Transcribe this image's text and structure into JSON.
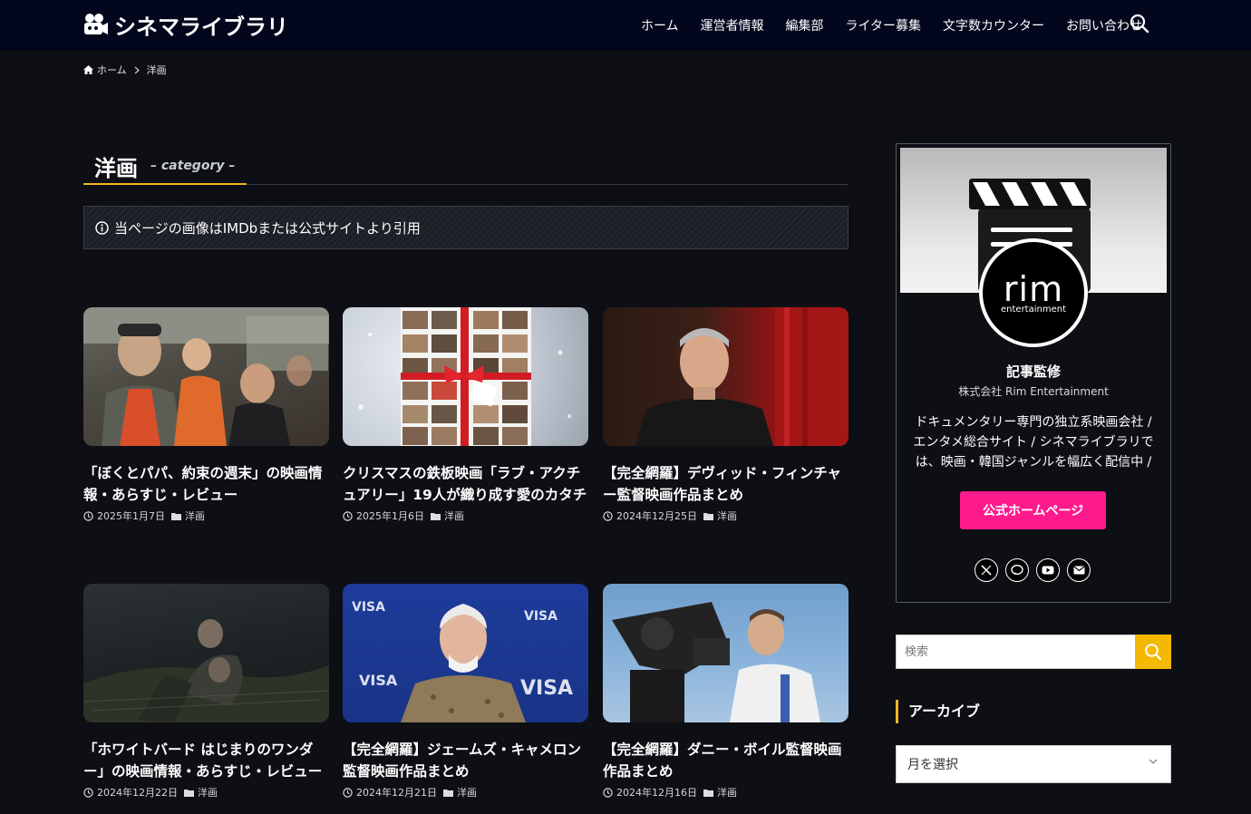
{
  "header": {
    "logo_text": "シネマライブラリ",
    "nav": [
      "ホーム",
      "運営者情報",
      "編集部",
      "ライター募集",
      "文字数カウンター",
      "お問い合わせ"
    ]
  },
  "breadcrumb": {
    "home": "ホーム",
    "current": "洋画"
  },
  "page": {
    "title": "洋画",
    "subtitle": "– category –"
  },
  "notice": "当ページの画像はIMDbまたは公式サイトより引用",
  "cards": [
    {
      "title": "「ぼくとパパ、約束の週末」の映画情報・あらすじ・レビュー",
      "date": "2025年1月7日",
      "category": "洋画"
    },
    {
      "title": "クリスマスの鉄板映画「ラブ・アクチュアリー」19人が織り成す愛のカタチ",
      "date": "2025年1月6日",
      "category": "洋画"
    },
    {
      "title": "【完全網羅】デヴィッド・フィンチャー監督映画作品まとめ",
      "date": "2024年12月25日",
      "category": "洋画"
    },
    {
      "title": "「ホワイトバード はじまりのワンダー」の映画情報・あらすじ・レビュー",
      "date": "2024年12月22日",
      "category": "洋画"
    },
    {
      "title": "【完全網羅】ジェームズ・キャメロン監督映画作品まとめ",
      "date": "2024年12月21日",
      "category": "洋画"
    },
    {
      "title": "【完全網羅】ダニー・ボイル監督映画作品まとめ",
      "date": "2024年12月16日",
      "category": "洋画"
    }
  ],
  "sidebar": {
    "avatar_main": "rim",
    "avatar_sub": "entertainment",
    "label": "記事監修",
    "company": "株式会社 Rim Entertainment",
    "description": "ドキュメンタリー専門の独立系映画会社 / エンタメ総合サイト / シネマライブラリでは、映画・韓国ジャンルを幅広く配信中 /",
    "button": "公式ホームページ",
    "socials": [
      "x-icon",
      "line-icon",
      "youtube-icon",
      "mail-icon"
    ],
    "search_placeholder": "検索",
    "archive_heading": "アーカイブ",
    "archive_select": "月を選択"
  },
  "colors": {
    "header_bg": "#03071e",
    "body_bg": "#0d0f14",
    "accent": "#f0b429",
    "button_pink": "#ff1a8c",
    "search_yellow": "#f5b800"
  }
}
